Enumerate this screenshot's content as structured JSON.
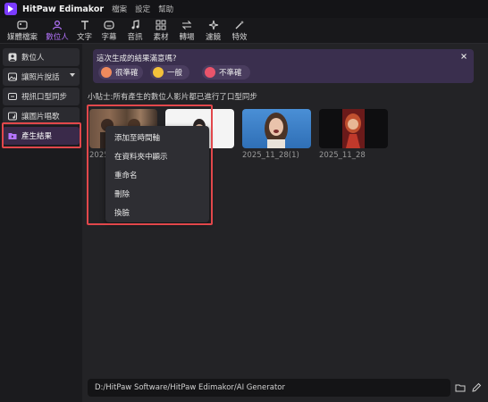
{
  "titlebar": {
    "app_title": "HitPaw Edimakor",
    "menus": [
      "檔案",
      "設定",
      "幫助"
    ]
  },
  "toolbar": {
    "tools": [
      {
        "label": "媒體檔案",
        "icon": "media-icon"
      },
      {
        "label": "數位人",
        "icon": "avatar-person-icon",
        "active": true
      },
      {
        "label": "文字",
        "icon": "text-icon"
      },
      {
        "label": "字幕",
        "icon": "subtitle-icon"
      },
      {
        "label": "音訊",
        "icon": "music-note-icon"
      },
      {
        "label": "素材",
        "icon": "stock-grid-icon"
      },
      {
        "label": "轉場",
        "icon": "transition-icon"
      },
      {
        "label": "濾鏡",
        "icon": "filter-sparkle-icon"
      },
      {
        "label": "特效",
        "icon": "effects-magic-icon"
      }
    ]
  },
  "sidebar": {
    "items": [
      {
        "label": "數位人"
      },
      {
        "label": "讓照片說話"
      },
      {
        "label": "視訊口型同步"
      },
      {
        "label": "讓圖片唱歌"
      },
      {
        "label": "產生結果"
      }
    ]
  },
  "feedback": {
    "question": "這次生成的結果滿意嗎?",
    "options": [
      "很準確",
      "一般",
      "不準確"
    ]
  },
  "tip": "小貼士:所有產生的數位人影片都已進行了口型同步",
  "results": {
    "captions": [
      "2025_1",
      "",
      "2025_11_28(1)",
      "2025_11_28"
    ]
  },
  "context_menu": {
    "items": [
      "添加至時間軸",
      "在資料夾中顯示",
      "重命名",
      "刪除",
      "換臉"
    ]
  },
  "path": "D:/HitPaw Software/HitPaw Edimakor/AI Generator",
  "colors": {
    "accent": "#b675ff",
    "highlight_box": "#e2474b",
    "banner": "#3a2f4e"
  }
}
